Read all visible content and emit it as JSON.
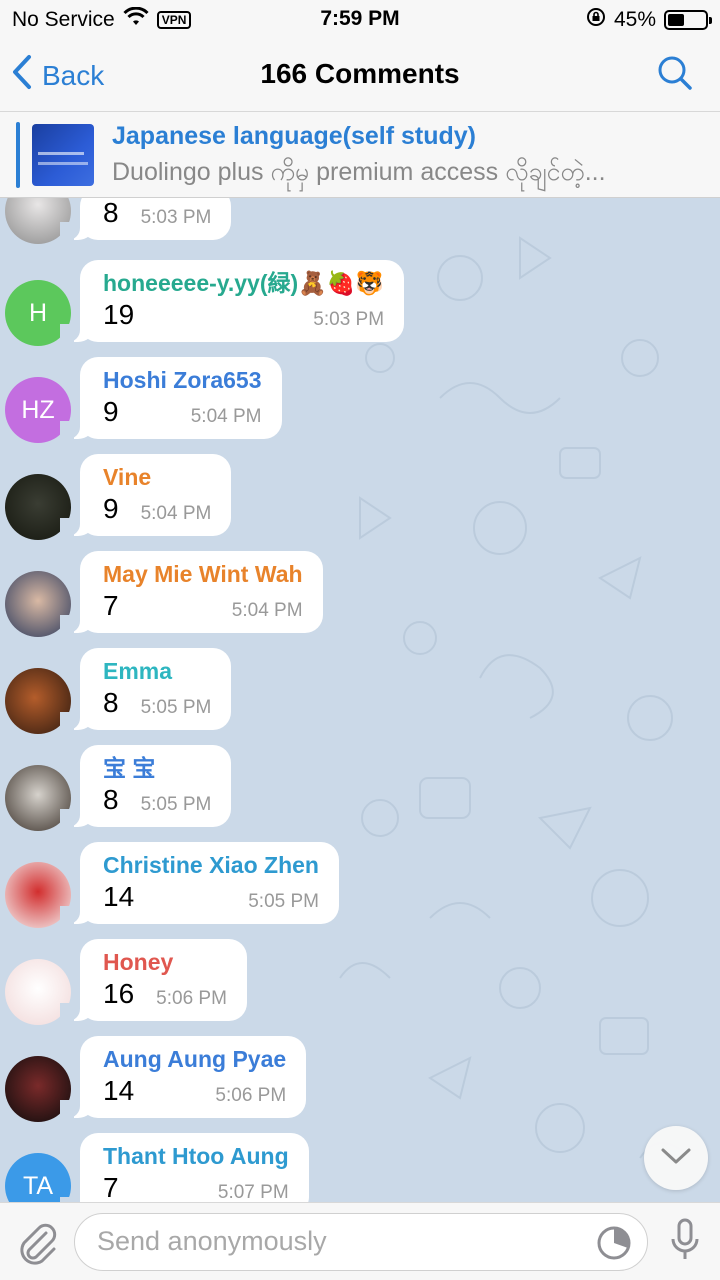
{
  "status_bar": {
    "carrier": "No Service",
    "vpn": "VPN",
    "time": "7:59 PM",
    "battery": "45%",
    "battery_level": 0.45
  },
  "nav": {
    "back_label": "Back",
    "title": "166 Comments"
  },
  "pinned": {
    "title": "Japanese language(self study)",
    "text": "Duolingo plus ကိုမှ premium access လိုချင်တဲ့..."
  },
  "messages": [
    {
      "name": "",
      "text": "8",
      "time": "5:03 PM",
      "avatar": "photo",
      "name_color": "#2e9ad0"
    },
    {
      "name": "honeeeee-y.yy(緑)🧸🍓🐯",
      "text": "19",
      "time": "5:03 PM",
      "avatar": "H",
      "avatar_color": "#5cc85c",
      "name_color": "#27a98f"
    },
    {
      "name": "Hoshi Zora653",
      "text": "9",
      "time": "5:04 PM",
      "avatar": "HZ",
      "avatar_color": "#c36ee0",
      "name_color": "#3b7dd8"
    },
    {
      "name": "Vine",
      "text": "9",
      "time": "5:04 PM",
      "avatar": "photo",
      "name_color": "#e8832b"
    },
    {
      "name": "May Mie Wint Wah",
      "text": "7",
      "time": "5:04 PM",
      "avatar": "photo",
      "name_color": "#e8832b"
    },
    {
      "name": "Emma",
      "text": "8",
      "time": "5:05 PM",
      "avatar": "photo",
      "name_color": "#2eb6c0"
    },
    {
      "name": "宝 宝",
      "text": "8",
      "time": "5:05 PM",
      "avatar": "photo",
      "name_color": "#3b7dd8"
    },
    {
      "name": "Christine Xiao Zhen",
      "text": "14",
      "time": "5:05 PM",
      "avatar": "photo",
      "name_color": "#2e9ad0"
    },
    {
      "name": "Honey",
      "text": "16",
      "time": "5:06 PM",
      "avatar": "photo",
      "name_color": "#e0574f"
    },
    {
      "name": "Aung Aung Pyae",
      "text": "14",
      "time": "5:06 PM",
      "avatar": "photo",
      "name_color": "#3b7dd8"
    },
    {
      "name": "Thant Htoo Aung",
      "text": "7",
      "time": "5:07 PM",
      "avatar": "TA",
      "avatar_color": "#3b9ae8",
      "name_color": "#2e9ad0"
    }
  ],
  "input": {
    "placeholder": "Send anonymously",
    "value": ""
  },
  "colors": {
    "accent": "#2b7fd4",
    "chat_background": "#cbd9e8"
  }
}
